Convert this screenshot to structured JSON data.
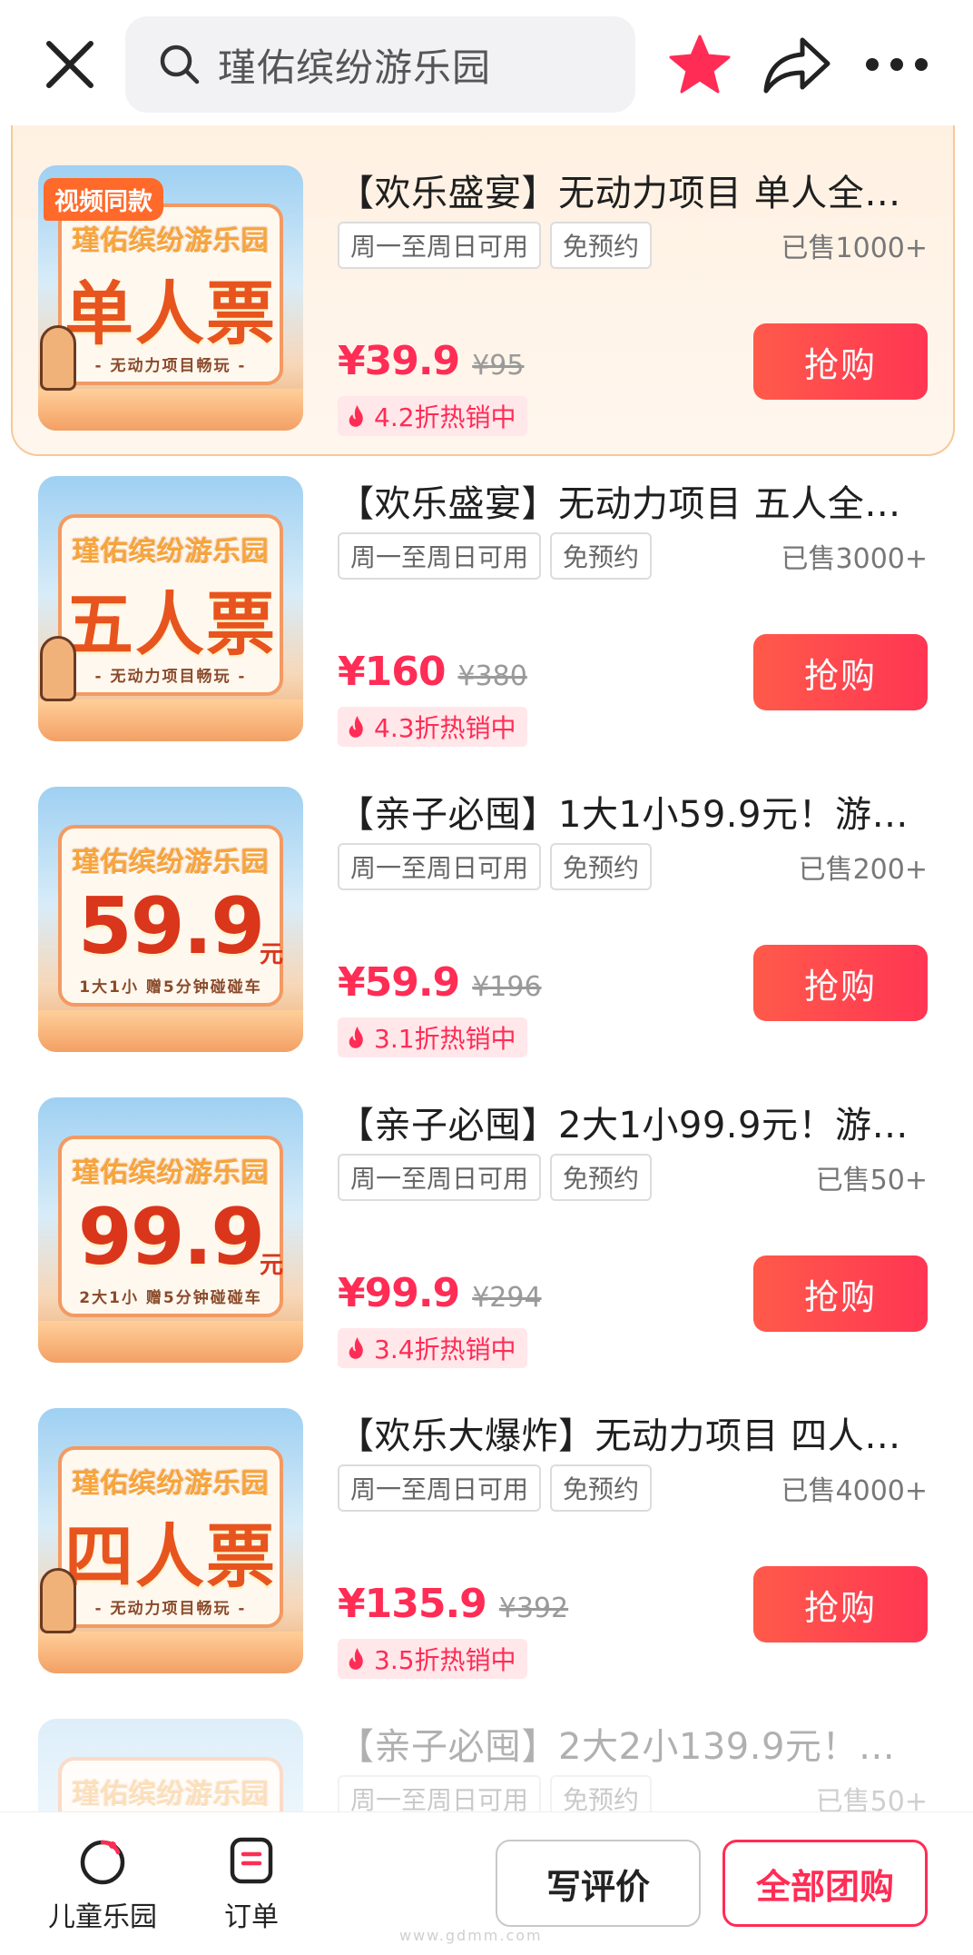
{
  "header": {
    "search_text": "瑾佑缤纷游乐园"
  },
  "colors": {
    "accent": "#ff2c55",
    "button_gradient_start": "#ff5a4a",
    "highlight_border": "#f6c89a"
  },
  "icons": [
    "close-icon",
    "search-icon",
    "star-icon",
    "share-icon",
    "more-icon",
    "fire-icon",
    "playground-icon",
    "order-icon"
  ],
  "items": [
    {
      "title": "【欢乐盛宴】无动力项目  单人全…",
      "tags": [
        "周一至周日可用",
        "免预约"
      ],
      "sold": "已售1000+",
      "price": "¥39.9",
      "original_price": "¥95",
      "discount": "4.2折热销中",
      "buy_label": "抢购",
      "thumb": {
        "video_tag": "视频同款",
        "brand": "瑾佑缤纷游乐园",
        "big": "单人票",
        "unit": "",
        "sub": "- 无动力项目畅玩 -"
      }
    },
    {
      "title": "【欢乐盛宴】无动力项目  五人全…",
      "tags": [
        "周一至周日可用",
        "免预约"
      ],
      "sold": "已售3000+",
      "price": "¥160",
      "original_price": "¥380",
      "discount": "4.3折热销中",
      "buy_label": "抢购",
      "thumb": {
        "video_tag": "",
        "brand": "瑾佑缤纷游乐园",
        "big": "五人票",
        "unit": "",
        "sub": "- 无动力项目畅玩 -"
      }
    },
    {
      "title": "【亲子必囤】1大1小59.9元！游…",
      "tags": [
        "周一至周日可用",
        "免预约"
      ],
      "sold": "已售200+",
      "price": "¥59.9",
      "original_price": "¥196",
      "discount": "3.1折热销中",
      "buy_label": "抢购",
      "thumb": {
        "video_tag": "",
        "brand": "瑾佑缤纷游乐园",
        "big": "59.9",
        "unit": "元",
        "sub": "1大1小  赠5分钟碰碰车"
      }
    },
    {
      "title": "【亲子必囤】2大1小99.9元！游…",
      "tags": [
        "周一至周日可用",
        "免预约"
      ],
      "sold": "已售50+",
      "price": "¥99.9",
      "original_price": "¥294",
      "discount": "3.4折热销中",
      "buy_label": "抢购",
      "thumb": {
        "video_tag": "",
        "brand": "瑾佑缤纷游乐园",
        "big": "99.9",
        "unit": "元",
        "sub": "2大1小  赠5分钟碰碰车"
      }
    },
    {
      "title": "【欢乐大爆炸】无动力项目  四人…",
      "tags": [
        "周一至周日可用",
        "免预约"
      ],
      "sold": "已售4000+",
      "price": "¥135.9",
      "original_price": "¥392",
      "discount": "3.5折热销中",
      "buy_label": "抢购",
      "thumb": {
        "video_tag": "",
        "brand": "瑾佑缤纷游乐园",
        "big": "四人票",
        "unit": "",
        "sub": "- 无动力项目畅玩 -"
      }
    },
    {
      "title": "【亲子必囤】2大2小139.9元！…",
      "tags": [
        "周一至周日可用",
        "免预约"
      ],
      "sold": "已售50+",
      "thumb": {
        "brand": "瑾佑缤纷游乐园"
      }
    }
  ],
  "bottom": {
    "nav_playground": "儿童乐园",
    "nav_orders": "订单",
    "review_label": "写评价",
    "all_groupbuy_label": "全部团购",
    "watermark": "www.gdmm.com"
  }
}
